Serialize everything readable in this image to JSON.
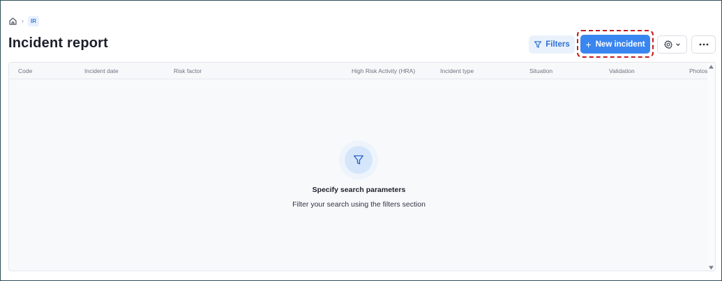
{
  "breadcrumb": {
    "home_icon": "home-icon",
    "separator": "›",
    "current": "IR"
  },
  "page": {
    "title": "Incident report"
  },
  "toolbar": {
    "filters_label": "Filters",
    "filters_icon": "filter-icon",
    "new_incident_label": "New incident",
    "new_incident_icon": "plus-icon",
    "settings_icon": "gear-icon",
    "more_icon": "ellipsis-icon"
  },
  "table": {
    "columns": [
      "Code",
      "Incident date",
      "Risk factor",
      "High Risk Activity (HRA)",
      "Incident type",
      "Situation",
      "Validation",
      "Photos"
    ],
    "rows": []
  },
  "empty_state": {
    "icon": "filter-icon",
    "title": "Specify search parameters",
    "description": "Filter your search using the filters section"
  },
  "colors": {
    "primary": "#3a86f0",
    "primary_soft": "#e9f2fc",
    "highlight": "#c41a1a"
  }
}
